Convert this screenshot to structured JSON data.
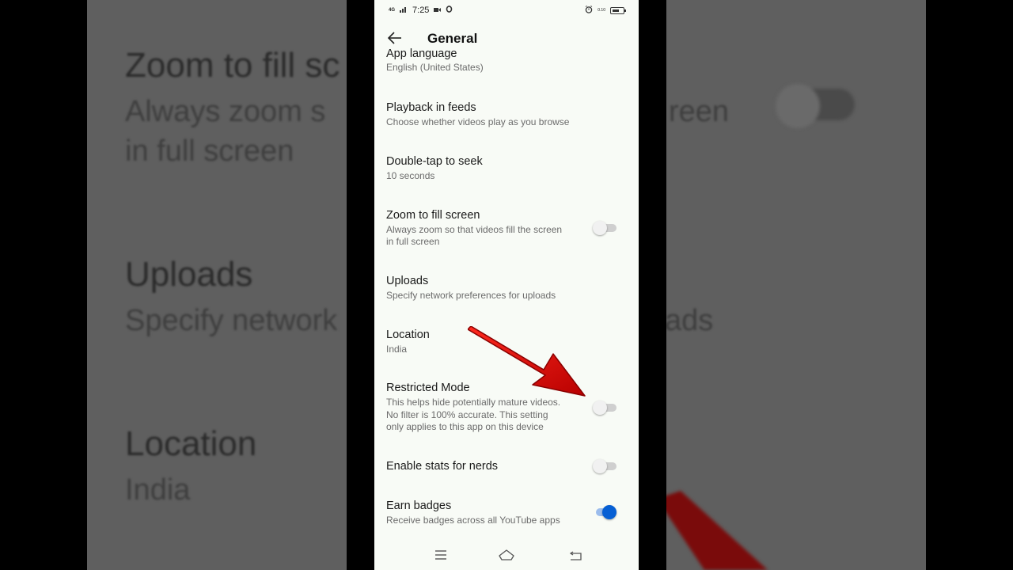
{
  "background_copy": {
    "zoom_title": "Zoom to fill sc",
    "zoom_sub_1": "Always zoom s",
    "zoom_sub_2": "in full screen",
    "zoom_sub_right": "reen",
    "uploads_title": "Uploads",
    "uploads_sub": "Specify network",
    "uploads_sub_right": "ads",
    "location_title": "Location",
    "location_sub": "India"
  },
  "status_bar": {
    "signal": "4G",
    "time": "7:25",
    "net_speed": "0.10"
  },
  "app_bar": {
    "title": "General",
    "back_icon": "arrow-left-icon"
  },
  "settings": [
    {
      "title": "App language",
      "subtitle": "English (United States)"
    },
    {
      "title": "Playback in feeds",
      "subtitle": "Choose whether videos play as you browse"
    },
    {
      "title": "Double-tap to seek",
      "subtitle": "10 seconds"
    },
    {
      "title": "Zoom to fill screen",
      "subtitle_line1": "Always zoom so that videos fill the screen",
      "subtitle_line2": "in full screen",
      "toggle_on": false
    },
    {
      "title": "Uploads",
      "subtitle": "Specify network preferences for uploads"
    },
    {
      "title": "Location",
      "subtitle": "India"
    },
    {
      "title": "Restricted Mode",
      "subtitle_line1": "This helps hide potentially mature videos.",
      "subtitle_line2": "No filter is 100% accurate. This setting",
      "subtitle_line3": "only applies to this app on this device",
      "toggle_on": false
    },
    {
      "title": "Enable stats for nerds",
      "toggle_on": false
    },
    {
      "title": "Earn badges",
      "subtitle": "Receive badges across all YouTube apps",
      "toggle_on": true
    }
  ],
  "colors": {
    "accent": "#065fd4",
    "annotation_arrow": "#e0120f",
    "screen_background": "#f8fbf6"
  },
  "nav_bar": {
    "menu_icon": "menu-icon",
    "home_icon": "home-icon",
    "back_icon": "back-icon"
  }
}
